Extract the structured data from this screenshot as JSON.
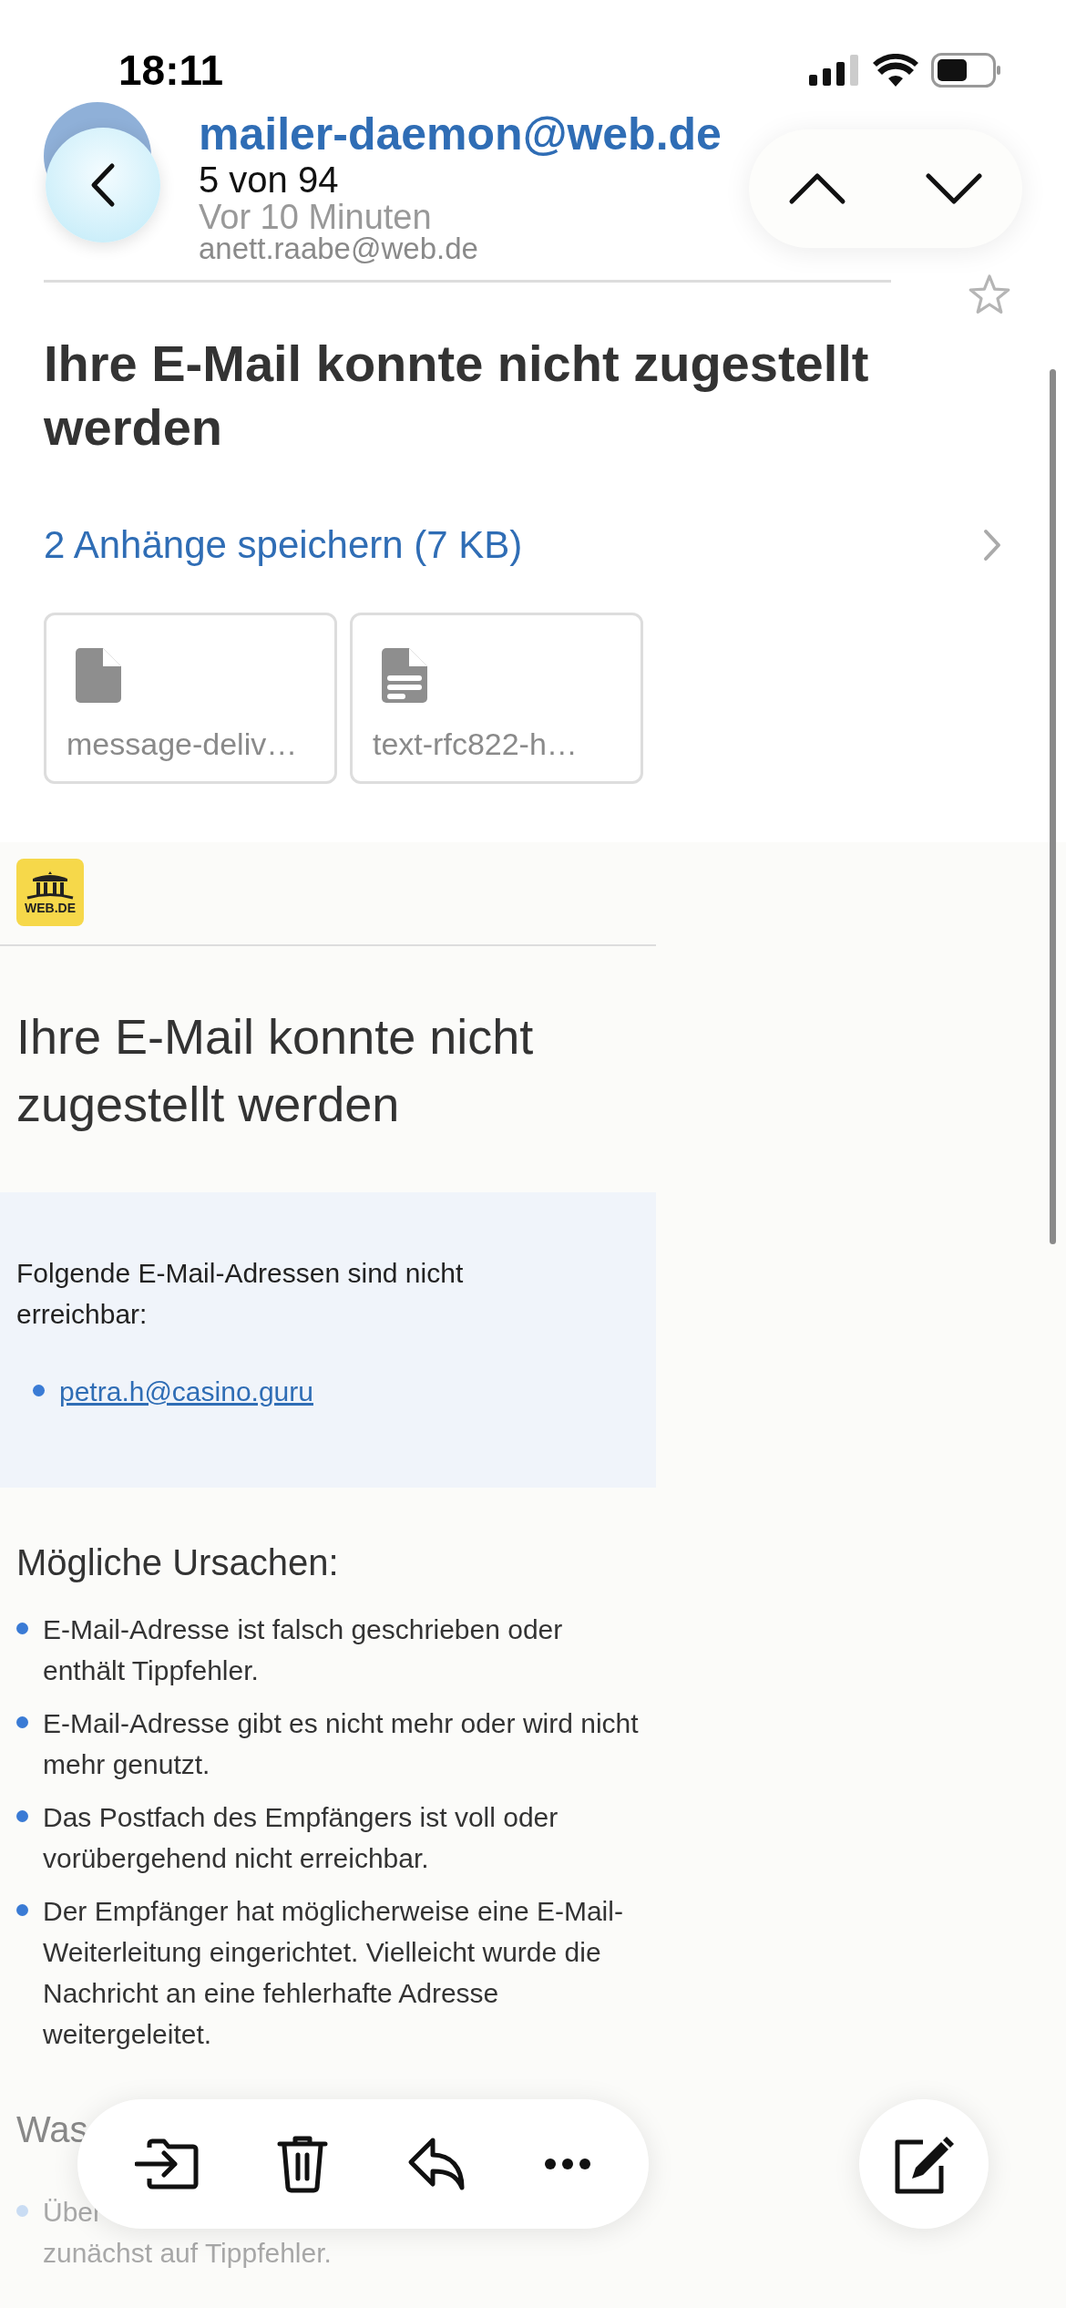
{
  "status_bar": {
    "time": "18:11"
  },
  "nav": {
    "position": "5 von 94"
  },
  "header": {
    "sender": "mailer-daemon@web.de",
    "time": "Vor 10 Minuten",
    "recipient": "anett.raabe@web.de",
    "starred": false
  },
  "subject": "Ihre E-Mail konnte nicht zugestellt werden",
  "attachments": {
    "save_label": "2 Anhänge speichern (7 KB)",
    "files": [
      {
        "name": "message-deliv…",
        "kind": "blank"
      },
      {
        "name": "text-rfc822-h…",
        "kind": "text"
      }
    ]
  },
  "body": {
    "logo": "WEB.DE",
    "heading": "Ihre E-Mail konnte nicht zugestellt werden",
    "notice": {
      "text": "Folgende E-Mail-Adressen sind nicht erreichbar:",
      "addresses": [
        "petra.h@casino.guru"
      ]
    },
    "causes_title": "Mögliche Ursachen:",
    "causes": [
      "E-Mail-Adresse ist falsch geschrieben oder enthält Tippfehler.",
      "E-Mail-Adresse gibt es nicht mehr oder wird nicht mehr genutzt.",
      "Das Postfach des Empfängers ist voll oder vorübergehend nicht erreichbar.",
      "Der Empfänger hat möglicherweise eine E-Mail-Weiterleitung eingerichtet. Vielleicht wurde die Nachricht an eine fehlerhafte Adresse weitergeleitet."
    ],
    "next_title": "Was",
    "next_items": [
      {
        "lines": [
          "Über",
          "zunächst auf Tippfehler."
        ]
      }
    ]
  }
}
